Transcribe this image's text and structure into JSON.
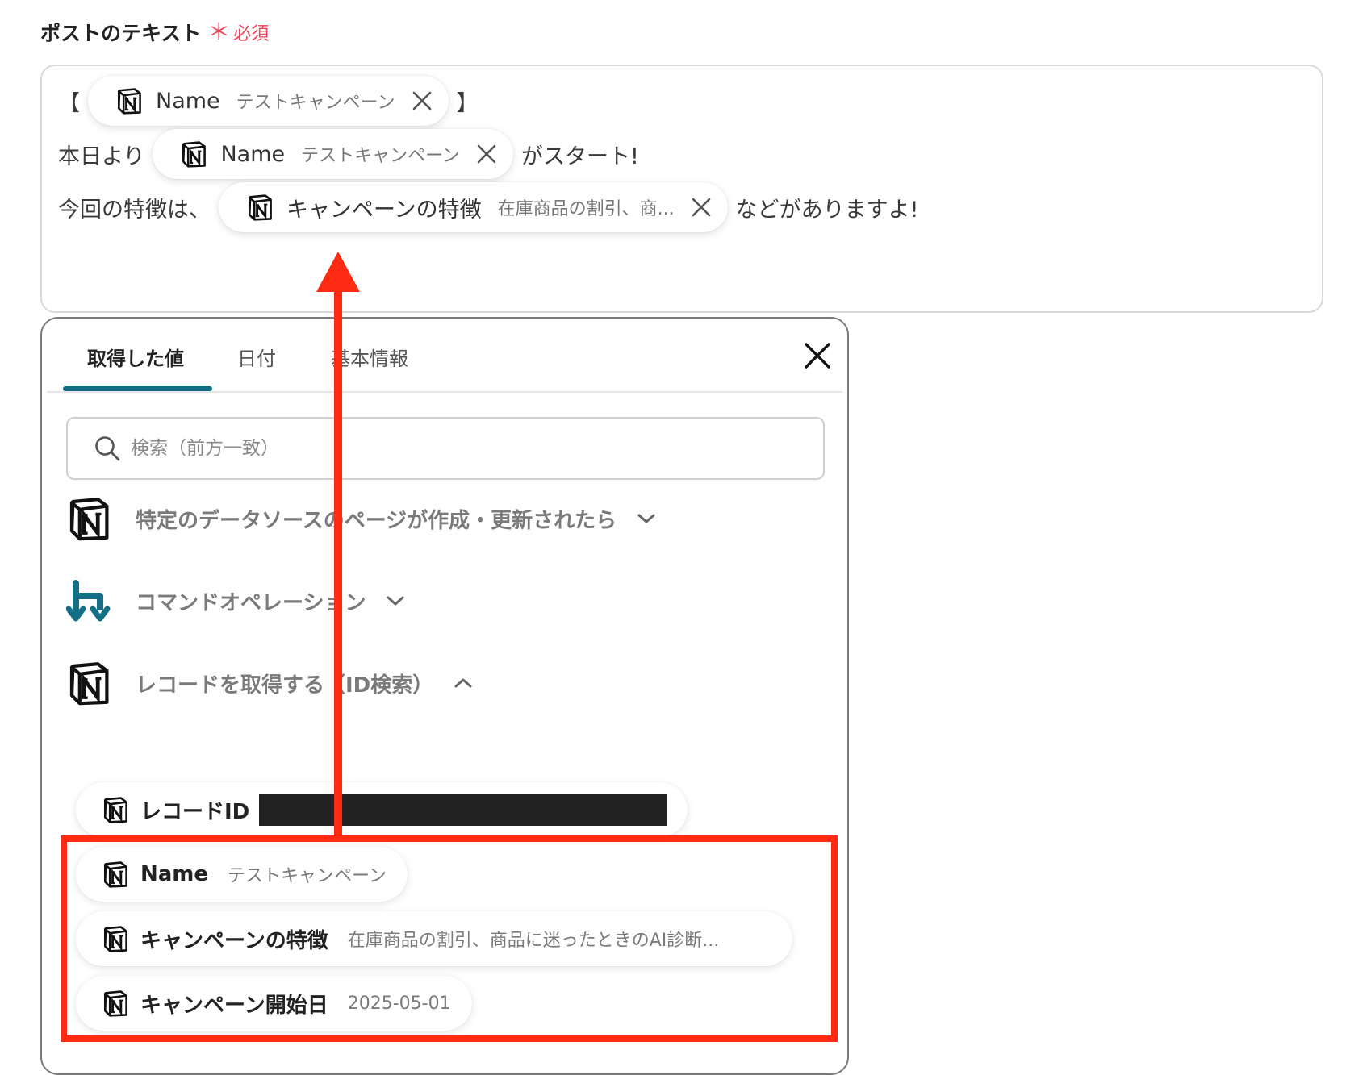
{
  "field": {
    "label": "ポストのテキスト",
    "required_mark": "＊",
    "required_text": "必須"
  },
  "editor": {
    "line1": {
      "prefix": "【",
      "chip_key": "Name",
      "chip_value": "テストキャンペーン",
      "suffix": "】"
    },
    "line2": {
      "prefix": "本日より",
      "chip_key": "Name",
      "chip_value": "テストキャンペーン",
      "suffix": "がスタート!"
    },
    "line3": {
      "prefix": "今回の特徴は、",
      "chip_key": "キャンペーンの特徴",
      "chip_value": "在庫商品の割引、商...",
      "suffix": "などがありますよ!"
    }
  },
  "panel": {
    "tabs": [
      {
        "label": "取得した値",
        "active": true
      },
      {
        "label": "日付",
        "active": false
      },
      {
        "label": "基本情報",
        "active": false
      }
    ],
    "search_placeholder": "検索（前方一致）",
    "sections": [
      {
        "title": "特定のデータソースのページが作成・更新されたら",
        "icon": "notion-icon",
        "expanded": false
      },
      {
        "title": "コマンドオペレーション",
        "icon": "command-operation-icon",
        "expanded": false
      },
      {
        "title": "レコードを取得する（ID検索）",
        "icon": "notion-icon",
        "expanded": true
      }
    ],
    "items": [
      {
        "key": "レコードID",
        "value": "",
        "redacted": true
      },
      {
        "key": "Name",
        "value": "テストキャンペーン"
      },
      {
        "key": "キャンペーンの特徴",
        "value": "在庫商品の割引、商品に迷ったときのAI診断..."
      },
      {
        "key": "キャンペーン開始日",
        "value": "2025-05-01"
      }
    ]
  },
  "colors": {
    "accent": "#0f6e86",
    "required": "#e8455a",
    "annotation": "#ff2a12"
  }
}
